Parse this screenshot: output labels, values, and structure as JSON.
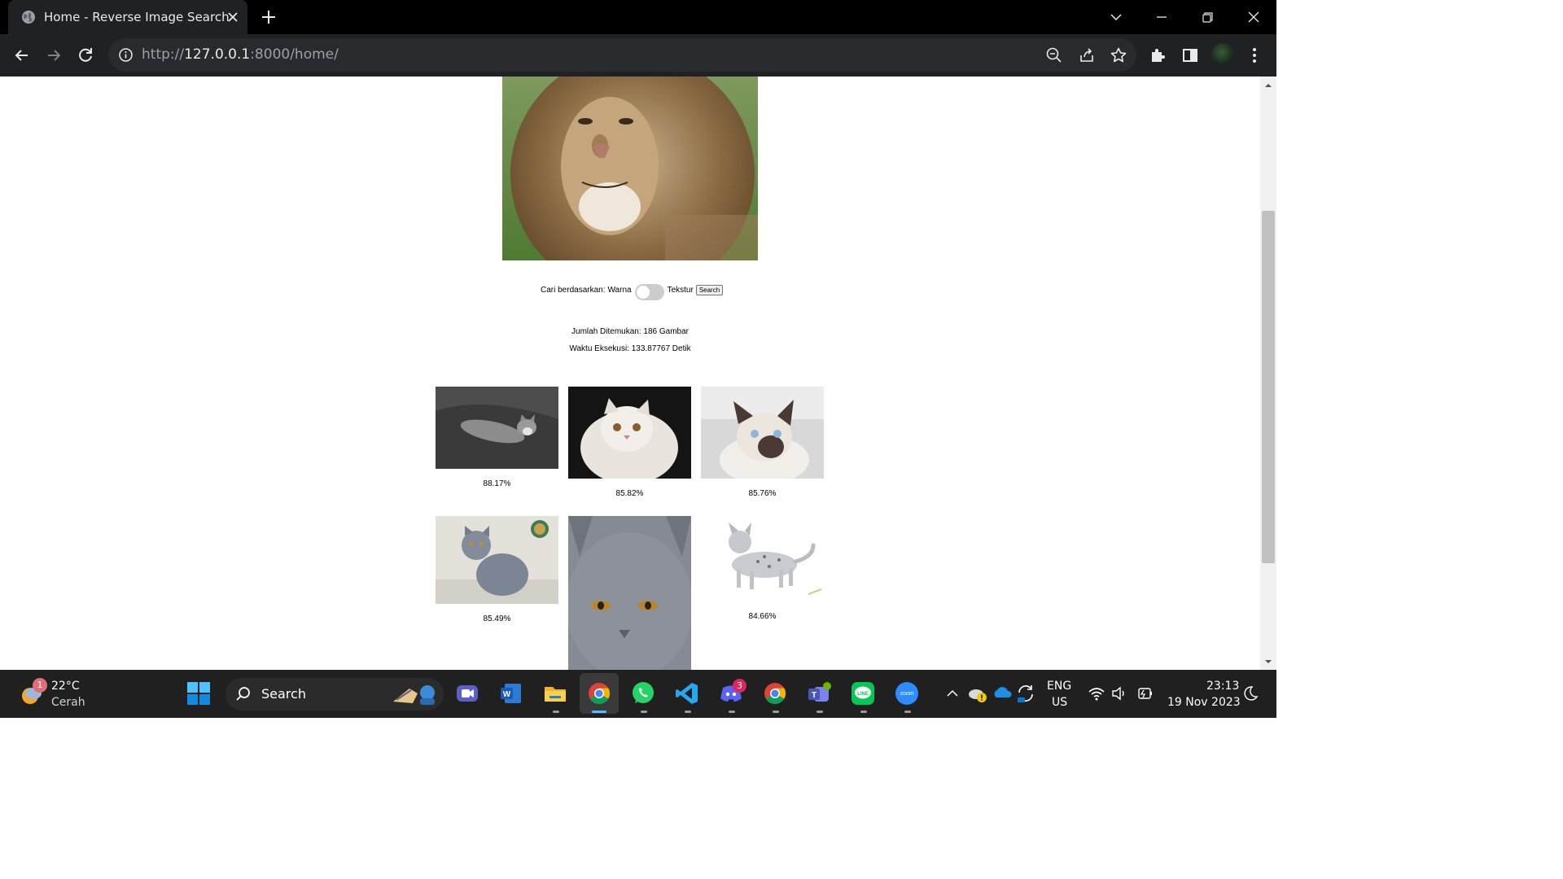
{
  "browser": {
    "tab_title": "Home - Reverse Image Search",
    "url_scheme": "http://",
    "url_host": "127.0.0.1",
    "url_rest": ":8000/home/"
  },
  "page": {
    "search_label_prefix": "Cari berdasarkan:",
    "option_left": "Warna",
    "option_right": "Tekstur",
    "toggle_state": "Warna",
    "search_button": "Search",
    "found_count": "Jumlah Ditemukan: 186 Gambar",
    "exec_time": "Waktu Eksekusi: 133.87767 Detik",
    "results": [
      {
        "percent": "88.17%",
        "subject": "grey cat lying on bed"
      },
      {
        "percent": "85.82%",
        "subject": "white persian cat"
      },
      {
        "percent": "85.76%",
        "subject": "siamese kitten"
      },
      {
        "percent": "85.49%",
        "subject": "grey british shorthair sitting"
      },
      {
        "percent": "",
        "subject": "grey cat face close-up"
      },
      {
        "percent": "84.66%",
        "subject": "spotted kitten walking"
      }
    ]
  },
  "taskbar": {
    "weather_temp": "22°C",
    "weather_desc": "Cerah",
    "weather_badge": "1",
    "search_label": "Search",
    "discord_badge": "3",
    "lang": "ENG",
    "region": "US",
    "time": "23:13",
    "date": "19 Nov 2023"
  },
  "colors": {
    "titlebar": "#000000",
    "toolbar": "#202124",
    "omnibox": "#282a2d",
    "taskbar": "#202020",
    "windows_blue": "#0078d4"
  }
}
